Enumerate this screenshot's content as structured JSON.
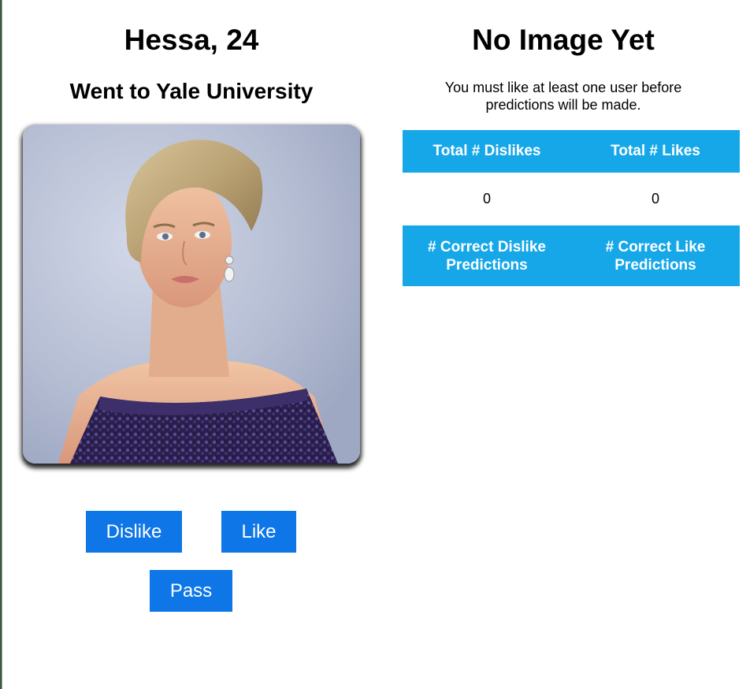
{
  "profile": {
    "name_age": "Hessa, 24",
    "school": "Went to Yale University",
    "photo_alt": "Profile photo"
  },
  "actions": {
    "dislike_label": "Dislike",
    "like_label": "Like",
    "pass_label": "Pass"
  },
  "prediction": {
    "title": "No Image Yet",
    "note": "You must like at least one user before predictions will be made."
  },
  "stats": {
    "headers": [
      "Total # Dislikes",
      "Total # Likes"
    ],
    "values": [
      "0",
      "0"
    ],
    "correct_headers": [
      "# Correct Dislike Predictions",
      "# Correct Like Predictions"
    ]
  },
  "colors": {
    "button": "#0e76e6",
    "table_header": "#16a7e8"
  }
}
